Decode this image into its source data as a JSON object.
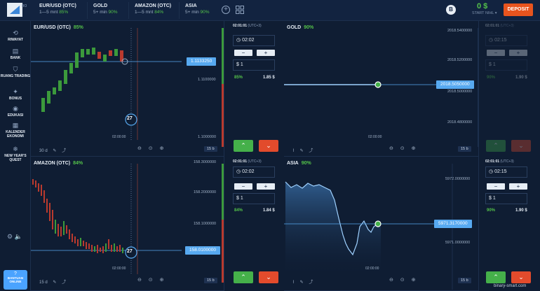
{
  "topbar": {
    "logo_badge": "BO",
    "tabs": [
      {
        "name": "EUR/USD (OTC)",
        "time": "1—5 mnt",
        "pct": "85%"
      },
      {
        "name": "GOLD",
        "time": "5+ min",
        "pct": "90%"
      },
      {
        "name": "AMAZON (OTC)",
        "time": "1—5 mnt",
        "pct": "84%"
      },
      {
        "name": "ASIA",
        "time": "5+ min",
        "pct": "90%"
      }
    ],
    "plus": "+",
    "coin": "B",
    "balance": "0 $",
    "account": "START NIHL ▾",
    "deposit": "DEPOSIT"
  },
  "sidebar": {
    "items": [
      {
        "icon": "⟲",
        "label": "RIWAYAT"
      },
      {
        "icon": "▤",
        "label": "BANK"
      },
      {
        "icon": "⛉",
        "label": "RUANG TRADING"
      },
      {
        "icon": "✦",
        "label": "BONUS"
      },
      {
        "icon": "◉",
        "label": "EDUKASI"
      },
      {
        "icon": "▦",
        "label": "KALENDER EKONOMI"
      },
      {
        "icon": "❄",
        "label": "NEW YEAR'S QUEST"
      }
    ],
    "bottom_icons": "⚙  🔈",
    "help_icon": "?",
    "help_label": "BANTUAN ONLINE"
  },
  "panels": [
    {
      "title": "EUR/USD (OTC)",
      "pct": "85%",
      "ticks": [
        "1.1100000",
        "1.1000000"
      ],
      "price": "1.1133250",
      "timer": "27",
      "time": "02:00:00",
      "tools": [
        "30 d",
        "✎",
        "⤴"
      ],
      "timeframe": "15 b",
      "zoom": "⊖ ⊙ ⊕"
    },
    {
      "title": "GOLD",
      "pct": "90%",
      "ticks": [
        "2018.5400000",
        "2018.5200000",
        "2018.5000000",
        "2018.4800000"
      ],
      "price": "2018.5050000",
      "time": "02:00:00",
      "tools": [
        "⌇",
        "✎",
        "⤴"
      ],
      "timeframe": "15 b",
      "zoom": "⊖ ⊙ ⊕"
    },
    {
      "title": "AMAZON (OTC)",
      "pct": "84%",
      "ticks": [
        "158.3000000",
        "158.2000000",
        "158.1000000"
      ],
      "price": "158.0100000",
      "timer": "27",
      "time": "02:00:00",
      "tools": [
        "15 d",
        "✎",
        "⤴"
      ],
      "timeframe": "15 b",
      "zoom": "⊖ ⊙ ⊕"
    },
    {
      "title": "ASIA",
      "pct": "90%",
      "ticks": [
        "5972.0000000",
        "5971.0000000"
      ],
      "price": "5971.3170000",
      "time": "02:00:00",
      "tools": [
        "⌇",
        "✎",
        "⤴"
      ],
      "timeframe": "15 b",
      "zoom": "⊖ ⊙ ⊕"
    }
  ],
  "trades": [
    {
      "time": "02:01:01",
      "tz": "(UTC+3)",
      "expiry": "02:02",
      "amount": "$ 1",
      "pct": "85%",
      "payout": "1.85 $"
    },
    {
      "time": "02:01:01",
      "tz": "(UTC+3)",
      "expiry": "02:15",
      "amount": "$ 1",
      "pct": "90%",
      "payout": "1.90 $"
    },
    {
      "time": "02:01:01",
      "tz": "(UTC+3)",
      "expiry": "02:02",
      "amount": "$ 1",
      "pct": "84%",
      "payout": "1.84 $"
    },
    {
      "time": "02:01:01",
      "tz": "(UTC+3)",
      "expiry": "02:15",
      "amount": "$ 1",
      "pct": "90%",
      "payout": "1.90 $"
    }
  ],
  "step": {
    "minus": "−",
    "plus": "+"
  },
  "buttons": {
    "up": "⌃",
    "down": "⌄"
  },
  "watermark": "binary-smart.com",
  "colors": {
    "up": "#45b04a",
    "down": "#e24b2c",
    "accent": "#57a9f0",
    "deposit": "#e8541e"
  }
}
